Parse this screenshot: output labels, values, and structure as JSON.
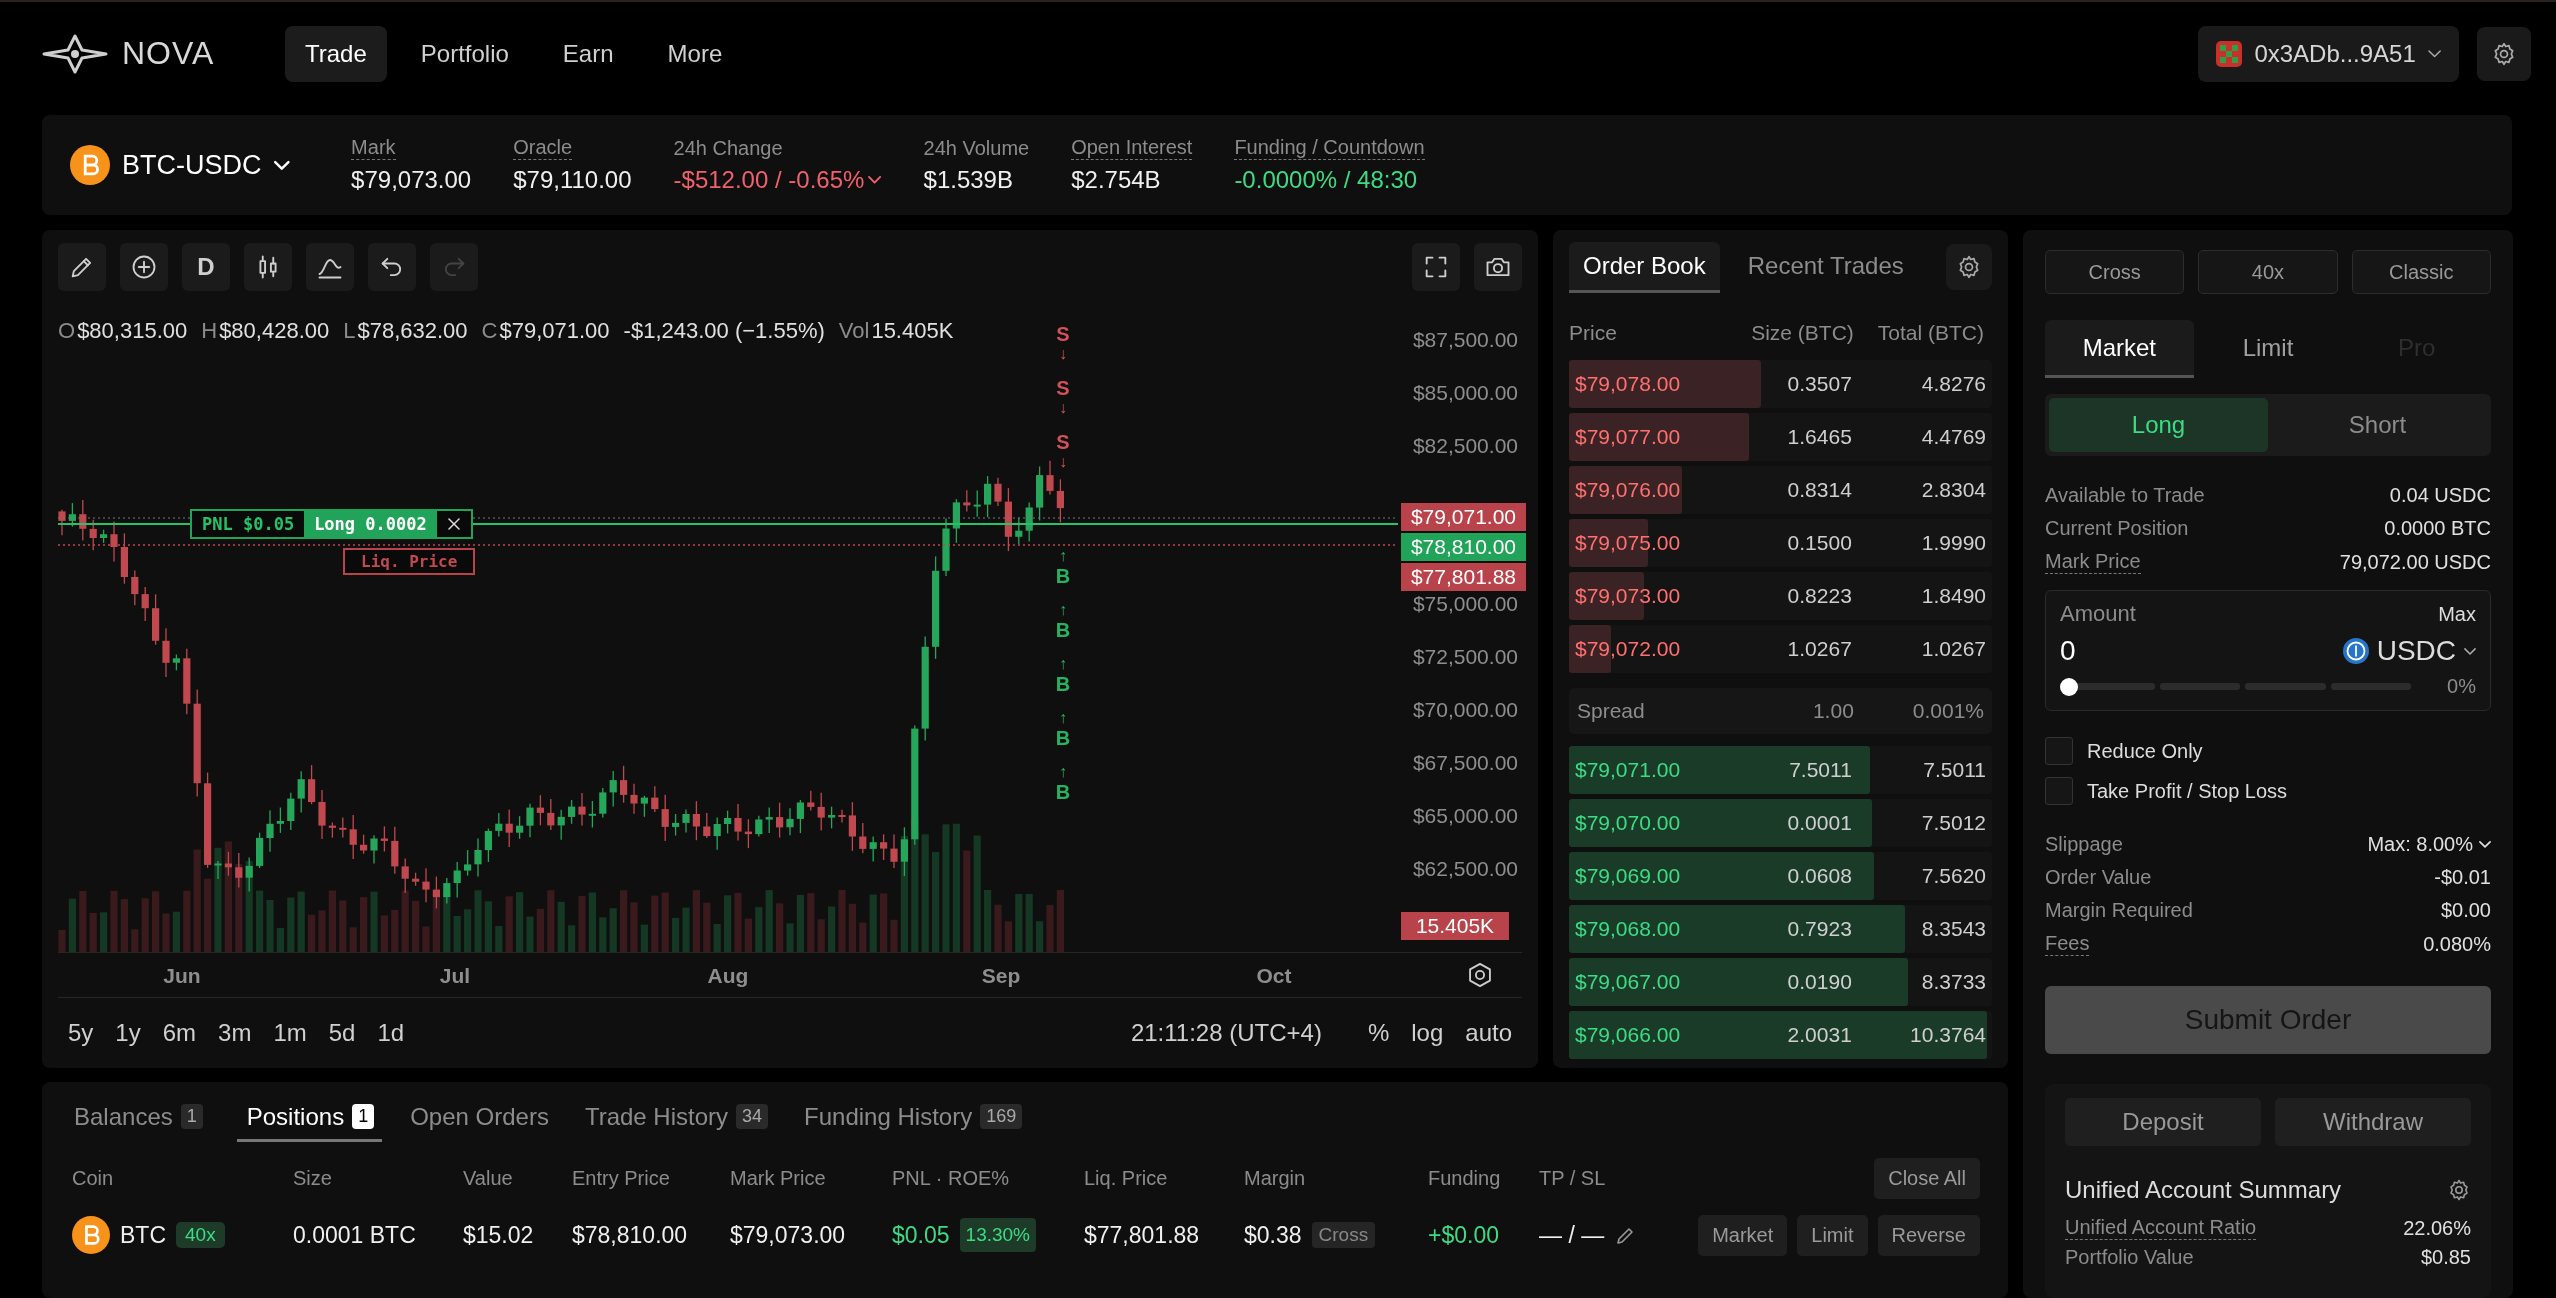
{
  "header": {
    "brand": "NOVA",
    "nav": [
      {
        "label": "Trade",
        "selected": true
      },
      {
        "label": "Portfolio",
        "selected": false
      },
      {
        "label": "Earn",
        "selected": false
      },
      {
        "label": "More",
        "selected": false
      }
    ],
    "wallet": "0x3ADb...9A51"
  },
  "market": {
    "symbol": "BTC-USDC",
    "stats": [
      {
        "label": "Mark",
        "value": "$79,073.00",
        "underlined": true,
        "color": "#f0f0f0",
        "caret": false
      },
      {
        "label": "Oracle",
        "value": "$79,110.00",
        "underlined": true,
        "color": "#f0f0f0",
        "caret": false
      },
      {
        "label": "24h Change",
        "value": "-$512.00 / -0.65%",
        "underlined": false,
        "color": "#f0616d",
        "caret": true
      },
      {
        "label": "24h Volume",
        "value": "$1.539B",
        "underlined": false,
        "color": "#f0f0f0",
        "caret": false
      },
      {
        "label": "Open Interest",
        "value": "$2.754B",
        "underlined": true,
        "color": "#f0f0f0",
        "caret": false
      },
      {
        "label": "Funding / Countdown",
        "value": "-0.0000% / 48:30",
        "underlined": true,
        "color": "#3ddc84",
        "caret": false
      }
    ]
  },
  "chart": {
    "tools": [
      {
        "kind": "draw",
        "disabled": false
      },
      {
        "kind": "add",
        "disabled": false
      },
      {
        "kind": "interval",
        "label": "D",
        "disabled": false
      },
      {
        "kind": "candles",
        "disabled": false
      },
      {
        "kind": "indicators",
        "disabled": false
      },
      {
        "kind": "undo",
        "disabled": false
      },
      {
        "kind": "redo",
        "disabled": true
      }
    ],
    "side_tools": [
      {
        "kind": "fullscreen"
      },
      {
        "kind": "snapshot"
      }
    ],
    "ohlc": [
      {
        "key": "O",
        "value": "$80,315.00"
      },
      {
        "key": "H",
        "value": "$80,428.00"
      },
      {
        "key": "L",
        "value": "$78,632.00"
      },
      {
        "key": "C",
        "value": "$79,071.00"
      }
    ],
    "change": "-$1,243.00 (−1.55%)",
    "volume": {
      "key": "Vol",
      "value": "15.405K"
    },
    "price_ticks": [
      "$87,500.00",
      "$85,000.00",
      "$82,500.00",
      "$75,000.00",
      "$72,500.00",
      "$70,000.00",
      "$67,500.00",
      "$65,000.00",
      "$62,500.00"
    ],
    "price_markers": [
      {
        "value": "$79,071.00",
        "color": "#b8434b"
      },
      {
        "value": "$78,810.00",
        "color": "#22a35a"
      },
      {
        "value": "$77,801.88",
        "color": "#b8434b"
      }
    ],
    "volume_marker": "15.405K",
    "position": {
      "pnl": "PNL $0.05",
      "side": "Long 0.0002",
      "liq_label": "Liq. Price"
    },
    "trade_markers": [
      {
        "kind": "sell",
        "label": "S",
        "arrow": "↓"
      },
      {
        "kind": "sell",
        "label": "S",
        "arrow": "↓"
      },
      {
        "kind": "sell",
        "label": "S",
        "arrow": "↓"
      },
      {
        "kind": "buy",
        "label": "B",
        "arrow": "↑"
      },
      {
        "kind": "buy",
        "label": "B",
        "arrow": "↑"
      },
      {
        "kind": "buy",
        "label": "B",
        "arrow": "↑"
      },
      {
        "kind": "buy",
        "label": "B",
        "arrow": "↑"
      },
      {
        "kind": "buy",
        "label": "B",
        "arrow": "↑"
      }
    ],
    "months": [
      "Jun",
      "Jul",
      "Aug",
      "Sep",
      "Oct"
    ],
    "ranges": [
      "5y",
      "1y",
      "6m",
      "3m",
      "1m",
      "5d",
      "1d"
    ],
    "time": "21:11:28 (UTC+4)",
    "scale_options": [
      "%",
      "log",
      "auto"
    ]
  },
  "order_book": {
    "tabs": [
      {
        "label": "Order Book",
        "selected": true
      },
      {
        "label": "Recent Trades",
        "selected": false
      }
    ],
    "columns": [
      "Price",
      "Size (BTC)",
      "Total (BTC)"
    ],
    "asks": [
      {
        "price": "$79,078.00",
        "size": "0.3507",
        "total": "4.8276",
        "level": 0.46
      },
      {
        "price": "$79,077.00",
        "size": "1.6465",
        "total": "4.4769",
        "level": 0.43
      },
      {
        "price": "$79,076.00",
        "size": "0.8314",
        "total": "2.8304",
        "level": 0.27
      },
      {
        "price": "$79,075.00",
        "size": "0.1500",
        "total": "1.9990",
        "level": 0.19
      },
      {
        "price": "$79,073.00",
        "size": "0.8223",
        "total": "1.8490",
        "level": 0.18
      },
      {
        "price": "$79,072.00",
        "size": "1.0267",
        "total": "1.0267",
        "level": 0.1
      }
    ],
    "spread": {
      "label": "Spread",
      "value": "1.00",
      "percent": "0.001%"
    },
    "bids": [
      {
        "price": "$79,071.00",
        "size": "7.5011",
        "total": "7.5011",
        "level": 0.72
      },
      {
        "price": "$79,070.00",
        "size": "0.0001",
        "total": "7.5012",
        "level": 0.725
      },
      {
        "price": "$79,069.00",
        "size": "0.0608",
        "total": "7.5620",
        "level": 0.73
      },
      {
        "price": "$79,068.00",
        "size": "0.7923",
        "total": "8.3543",
        "level": 0.805
      },
      {
        "price": "$79,067.00",
        "size": "0.0190",
        "total": "8.3733",
        "level": 0.81
      },
      {
        "price": "$79,066.00",
        "size": "2.0031",
        "total": "10.3764",
        "level": 1.0
      }
    ]
  },
  "order_form": {
    "modes": [
      "Cross",
      "40x",
      "Classic"
    ],
    "order_types": [
      {
        "label": "Market",
        "selected": true,
        "disabled": false
      },
      {
        "label": "Limit",
        "selected": false,
        "disabled": false
      },
      {
        "label": "Pro",
        "selected": false,
        "disabled": true
      }
    ],
    "sides": [
      {
        "label": "Long",
        "selected": true
      },
      {
        "label": "Short",
        "selected": false
      }
    ],
    "info": [
      {
        "label": "Available to Trade",
        "value": "0.04 USDC",
        "underlined": false
      },
      {
        "label": "Current Position",
        "value": "0.0000 BTC",
        "underlined": false
      },
      {
        "label": "Mark Price",
        "value": "79,072.00 USDC",
        "underlined": true
      }
    ],
    "amount": {
      "label": "Amount",
      "max": "Max",
      "value": "0",
      "currency": "USDC",
      "level": 0,
      "percent": "0%"
    },
    "checkboxes": [
      {
        "label": "Reduce Only",
        "checked": false
      },
      {
        "label": "Take Profit / Stop Loss",
        "checked": false
      }
    ],
    "summary": [
      {
        "label": "Slippage",
        "value": "Max: 8.00%",
        "underlined": false,
        "caret": true
      },
      {
        "label": "Order Value",
        "value": "-$0.01",
        "underlined": false,
        "caret": false
      },
      {
        "label": "Margin Required",
        "value": "$0.00",
        "underlined": false,
        "caret": false
      },
      {
        "label": "Fees",
        "value": "0.080%",
        "underlined": true,
        "caret": false
      }
    ],
    "submit": {
      "label": "Submit Order",
      "disabled": true
    },
    "account": {
      "buttons": [
        "Deposit",
        "Withdraw"
      ],
      "title": "Unified Account Summary",
      "rows": [
        {
          "label": "Unified Account Ratio",
          "value": "22.06%",
          "underlined": true
        },
        {
          "label": "Portfolio Value",
          "value": "$0.85",
          "underlined": false
        }
      ]
    }
  },
  "positions": {
    "tabs": [
      {
        "label": "Balances",
        "count": "1",
        "selected": false
      },
      {
        "label": "Positions",
        "count": "1",
        "selected": true
      },
      {
        "label": "Open Orders",
        "selected": false
      },
      {
        "label": "Trade History",
        "count": "34",
        "selected": false
      },
      {
        "label": "Funding History",
        "count": "169",
        "selected": false
      }
    ],
    "columns": [
      "Coin",
      "Size",
      "Value",
      "Entry Price",
      "Mark Price",
      "PNL · ROE%",
      "Liq. Price",
      "Margin",
      "Funding",
      "TP / SL"
    ],
    "close_all": "Close All",
    "rows": [
      {
        "coin": "BTC",
        "leverage": "40x",
        "size": "0.0001 BTC",
        "value": "$15.02",
        "entry": "$78,810.00",
        "mark": "$79,073.00",
        "pnl": "$0.05",
        "roe": "13.30%",
        "liq": "$77,801.88",
        "margin": "$0.38",
        "margin_mode": "Cross",
        "funding": "+$0.00",
        "tpsl": "— / —",
        "actions": [
          "Market",
          "Limit",
          "Reverse"
        ]
      }
    ]
  }
}
